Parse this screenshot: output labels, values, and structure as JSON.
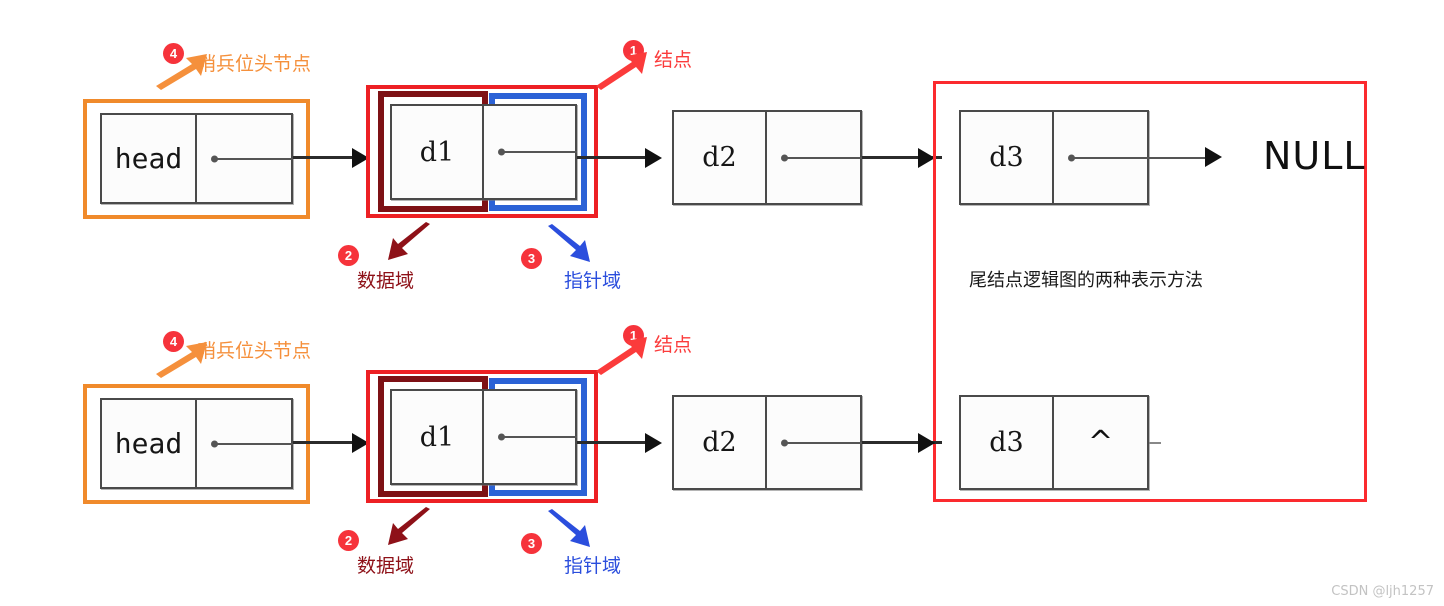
{
  "diagram": {
    "title_note": "尾结点逻辑图的两种表示方法",
    "watermark": "CSDN @ljh1257",
    "colors": {
      "orange": "#F08A2B",
      "red": "#ED2024",
      "dark_red": "#7E1115",
      "blue": "#2B62D6",
      "big_red": "#FB2A2E",
      "badge": "#F6333B",
      "node_border": "#4a4a4a"
    }
  },
  "rows": [
    {
      "id": "row-top",
      "nodes": [
        {
          "id": "head",
          "data": "head",
          "pointer": ""
        },
        {
          "id": "d1",
          "data": "d1",
          "pointer": ""
        },
        {
          "id": "d2",
          "data": "d2",
          "pointer": ""
        },
        {
          "id": "d3",
          "data": "d3",
          "pointer": ""
        }
      ],
      "terminator": "NULL"
    },
    {
      "id": "row-bottom",
      "nodes": [
        {
          "id": "head",
          "data": "head",
          "pointer": ""
        },
        {
          "id": "d1",
          "data": "d1",
          "pointer": ""
        },
        {
          "id": "d2",
          "data": "d2",
          "pointer": ""
        },
        {
          "id": "d3",
          "data": "d3",
          "pointer": "^"
        }
      ],
      "terminator": ""
    }
  ],
  "callouts_top": [
    {
      "num": "4",
      "label": "哨兵位头节点",
      "color": "orange"
    },
    {
      "num": "1",
      "label": "结点",
      "color": "red"
    },
    {
      "num": "2",
      "label": "数据域",
      "color": "dark_red"
    },
    {
      "num": "3",
      "label": "指针域",
      "color": "blue"
    }
  ],
  "callouts_bottom": [
    {
      "num": "4",
      "label": "哨兵位头节点",
      "color": "orange"
    },
    {
      "num": "1",
      "label": "结点",
      "color": "red"
    },
    {
      "num": "2",
      "label": "数据域",
      "color": "dark_red"
    },
    {
      "num": "3",
      "label": "指针域",
      "color": "blue"
    }
  ]
}
